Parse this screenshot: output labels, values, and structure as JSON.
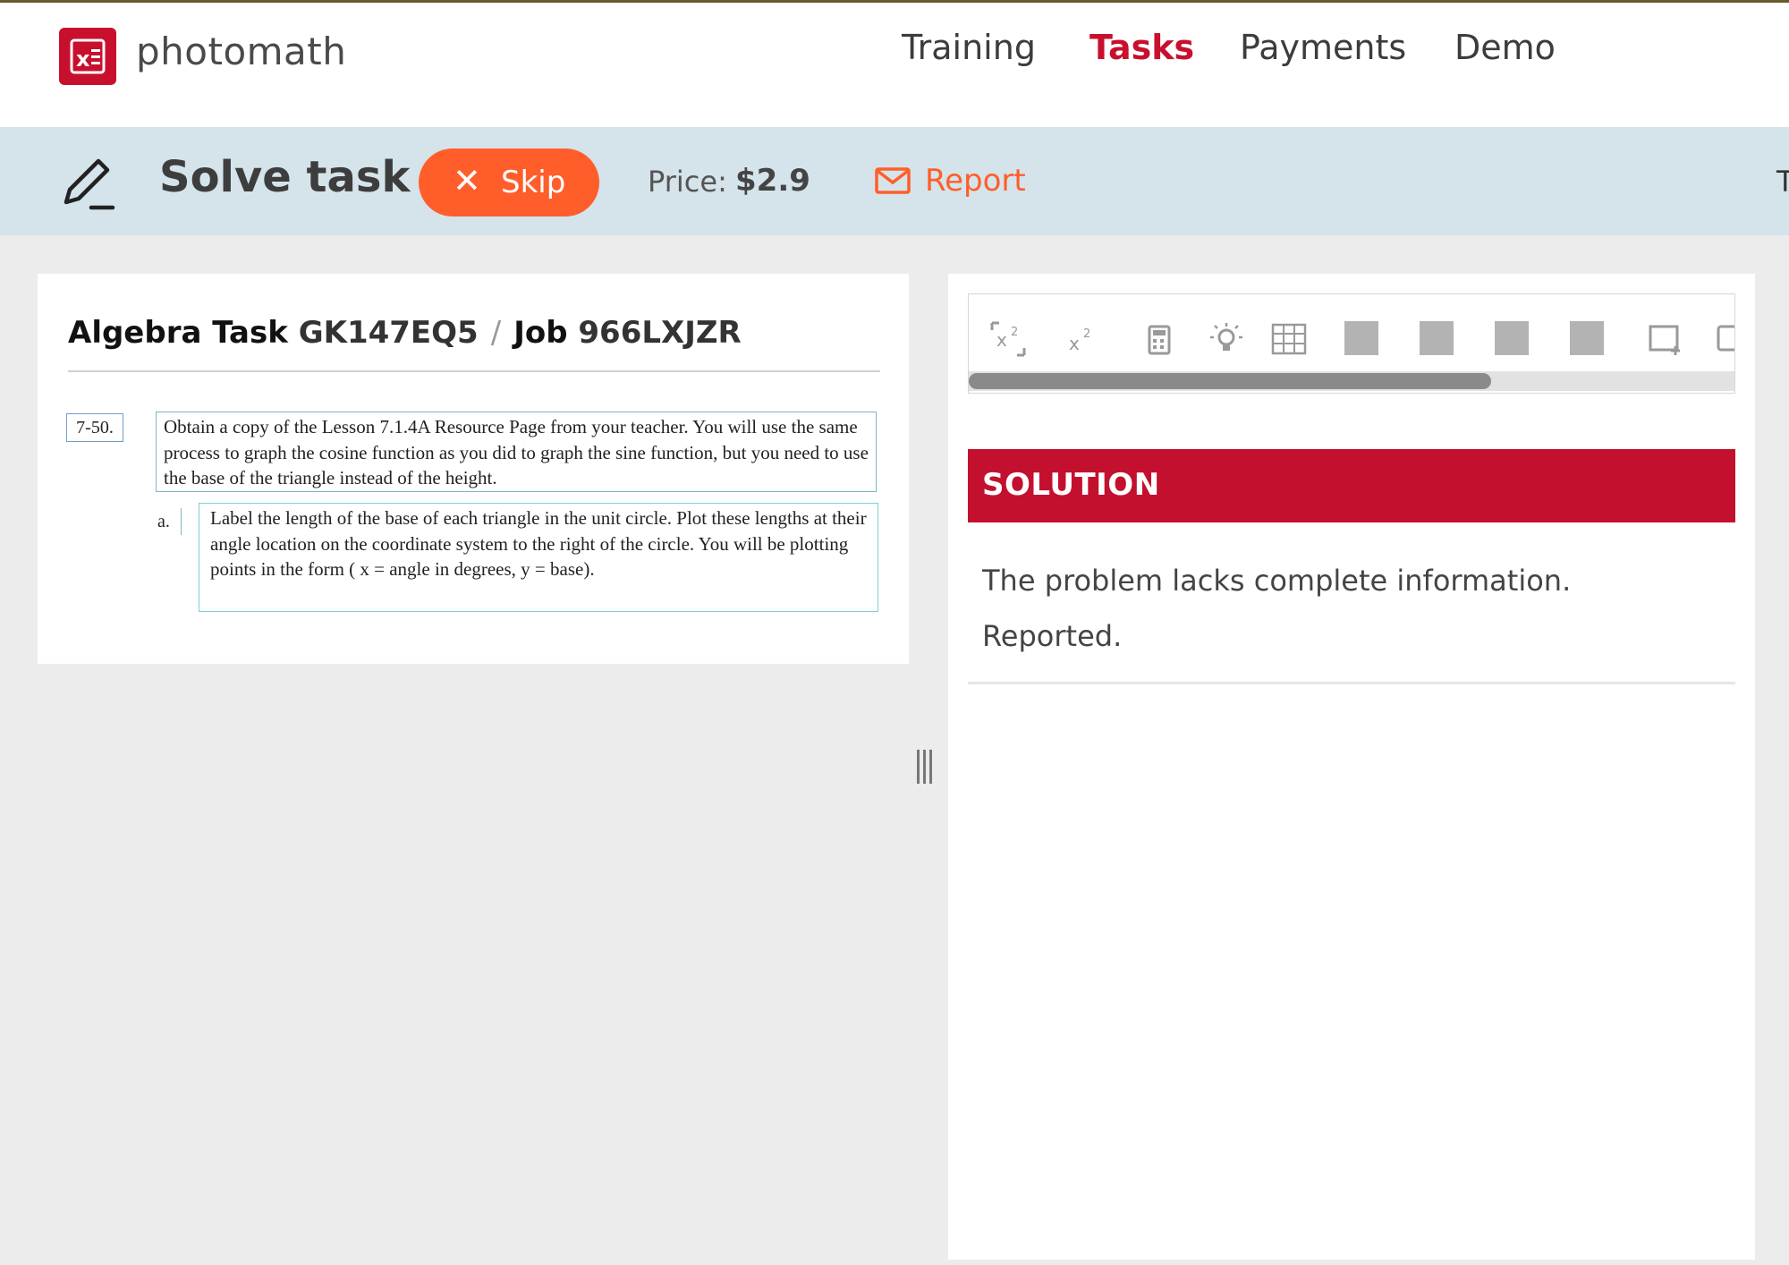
{
  "brand": {
    "name": "photomath",
    "accent": "#c8102e"
  },
  "nav": {
    "items": [
      {
        "label": "Training",
        "active": false
      },
      {
        "label": "Tasks",
        "active": true
      },
      {
        "label": "Payments",
        "active": false
      },
      {
        "label": "Demo",
        "active": false
      }
    ]
  },
  "actionbar": {
    "title": "Solve task",
    "skip_label": "Skip",
    "price_label": "Price:",
    "price_value": "$2.9",
    "report_label": "Report",
    "cutoff_text": "T",
    "skip_color": "#ff5e2a"
  },
  "task": {
    "subject": "Algebra Task",
    "task_code": "GK147EQ5",
    "separator": "/",
    "job_label": "Job",
    "job_code": "966LXJZR",
    "problem_number": "7-50.",
    "problem_text": "Obtain a copy of the Lesson 7.1.4A Resource Page from your teacher.  You will use the same process to graph the cosine function as you did to graph the sine function, but you need to use the base of the triangle instead of the height.",
    "sub_label": "a.",
    "sub_text": "Label the length of the base of each triangle in the unit circle.  Plot these lengths at their angle location on the coordinate system to the right of the circle.  You will be plotting points in the form ( x = angle in degrees, y = base)."
  },
  "editor": {
    "tools": [
      "matrix-subscript-icon",
      "superscript-icon",
      "calculator-icon",
      "hint-lightbulb-icon",
      "table-grid-icon",
      "placeholder-square-icon",
      "placeholder-square-icon",
      "placeholder-square-icon",
      "placeholder-square-icon",
      "insert-box-icon",
      "overflow-icon"
    ]
  },
  "solution": {
    "header": "SOLUTION",
    "lines": [
      "The problem lacks complete information.",
      "Reported."
    ],
    "header_color": "#c4102f"
  }
}
